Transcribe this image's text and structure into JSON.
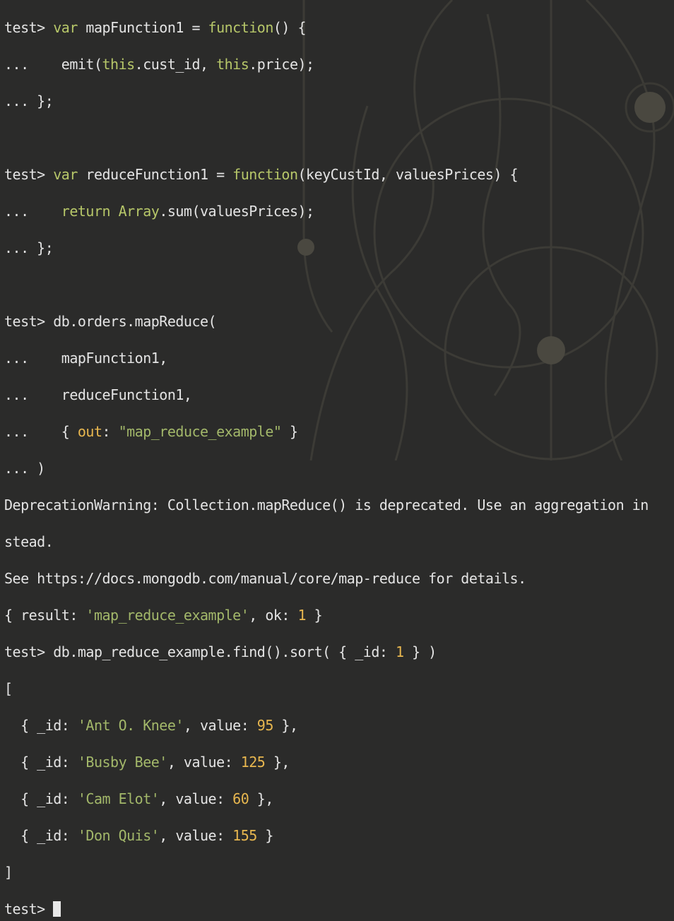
{
  "terminal": {
    "prompt": "test> ",
    "cont": "... ",
    "line1": {
      "var": "var",
      "name": " mapFunction1 = ",
      "fn": "function",
      "rest": "() {"
    },
    "line2": {
      "pre": "   emit(",
      "this1": "this",
      "mid": ".cust_id, ",
      "this2": "this",
      "end": ".price);"
    },
    "line3": "};",
    "line5": {
      "var": "var",
      "name": " reduceFunction1 = ",
      "fn": "function",
      "rest": "(keyCustId, valuesPrices) {"
    },
    "line6": {
      "ret": "return",
      "sp": " ",
      "arr": "Array",
      "rest": ".sum(valuesPrices);"
    },
    "line7": "};",
    "line9": "db.orders.mapReduce(",
    "line10": "   mapFunction1,",
    "line11": "   reduceFunction1,",
    "line12": {
      "pre": "   { ",
      "key": "out",
      "mid": ": ",
      "str": "\"map_reduce_example\"",
      "end": " }"
    },
    "line13": ")",
    "warn1": "DeprecationWarning: Collection.mapReduce() is deprecated. Use an aggregation in",
    "warn2": "stead.",
    "warn3": "See https://docs.mongodb.com/manual/core/map-reduce for details.",
    "result": {
      "pre": "{ result: ",
      "str": "'map_reduce_example'",
      "mid": ", ok: ",
      "num": "1",
      "end": " }"
    },
    "find": {
      "pre": "db.map_reduce_example.find().sort( { _id: ",
      "num": "1",
      "end": " } )"
    },
    "open_bracket": "[",
    "close_bracket": "]",
    "rows": [
      {
        "id": "'Ant O. Knee'",
        "value": "95",
        "sep": " },"
      },
      {
        "id": "'Busby Bee'",
        "value": "125",
        "sep": " },"
      },
      {
        "id": "'Cam Elot'",
        "value": "60",
        "sep": " },"
      },
      {
        "id": "'Don Quis'",
        "value": "155",
        "sep": " }"
      }
    ],
    "row_pre": "  { _id: ",
    "row_mid": ", value: "
  }
}
